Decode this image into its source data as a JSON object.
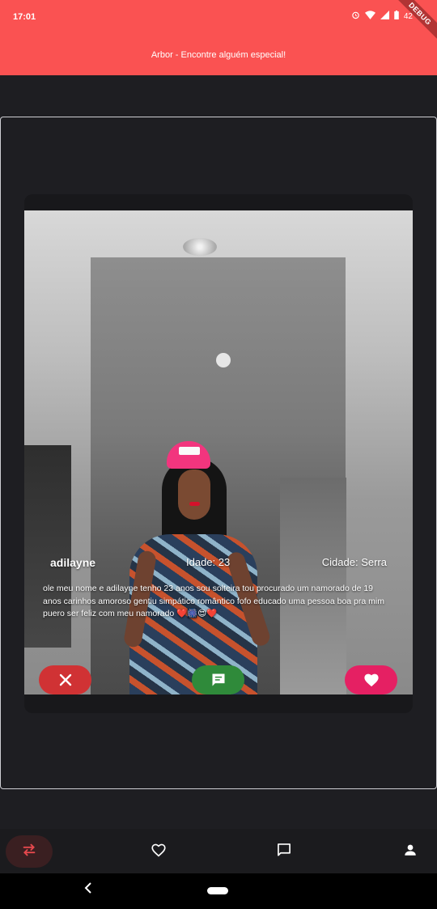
{
  "status_bar": {
    "time": "17:01",
    "battery": "42",
    "icons": [
      "alarm-icon",
      "wifi-icon",
      "signal-icon",
      "battery-icon"
    ]
  },
  "debug_banner": "DEBUG",
  "app_bar": {
    "title": "Arbor - Encontre alguém especial!",
    "color": "#fa5252"
  },
  "profile": {
    "name": "adilayne",
    "age_label": "Idade: 23",
    "city_label": "Cidade: Serra",
    "bio": "ole meu nome e adilayne tenho 23 anos sou solteira tou procurado um namorado de 19 anos carinhos amoroso gentiu simpático romântico fofo educado uma pessoa boa pra mim puero ser feliz com meu namorado ❤️🎆😍❤️"
  },
  "actions": {
    "dislike_icon": "close-icon",
    "chat_icon": "chat-icon",
    "like_icon": "heart-icon",
    "colors": {
      "dislike": "#d03234",
      "chat": "#2f8a3a",
      "like": "#e52063"
    }
  },
  "bottom_nav": {
    "items": [
      {
        "icon": "swap-icon",
        "active": true
      },
      {
        "icon": "heart-outline-icon",
        "active": false
      },
      {
        "icon": "chat-outline-icon",
        "active": false
      },
      {
        "icon": "person-icon",
        "active": false
      }
    ],
    "accent": "#e5484d"
  }
}
